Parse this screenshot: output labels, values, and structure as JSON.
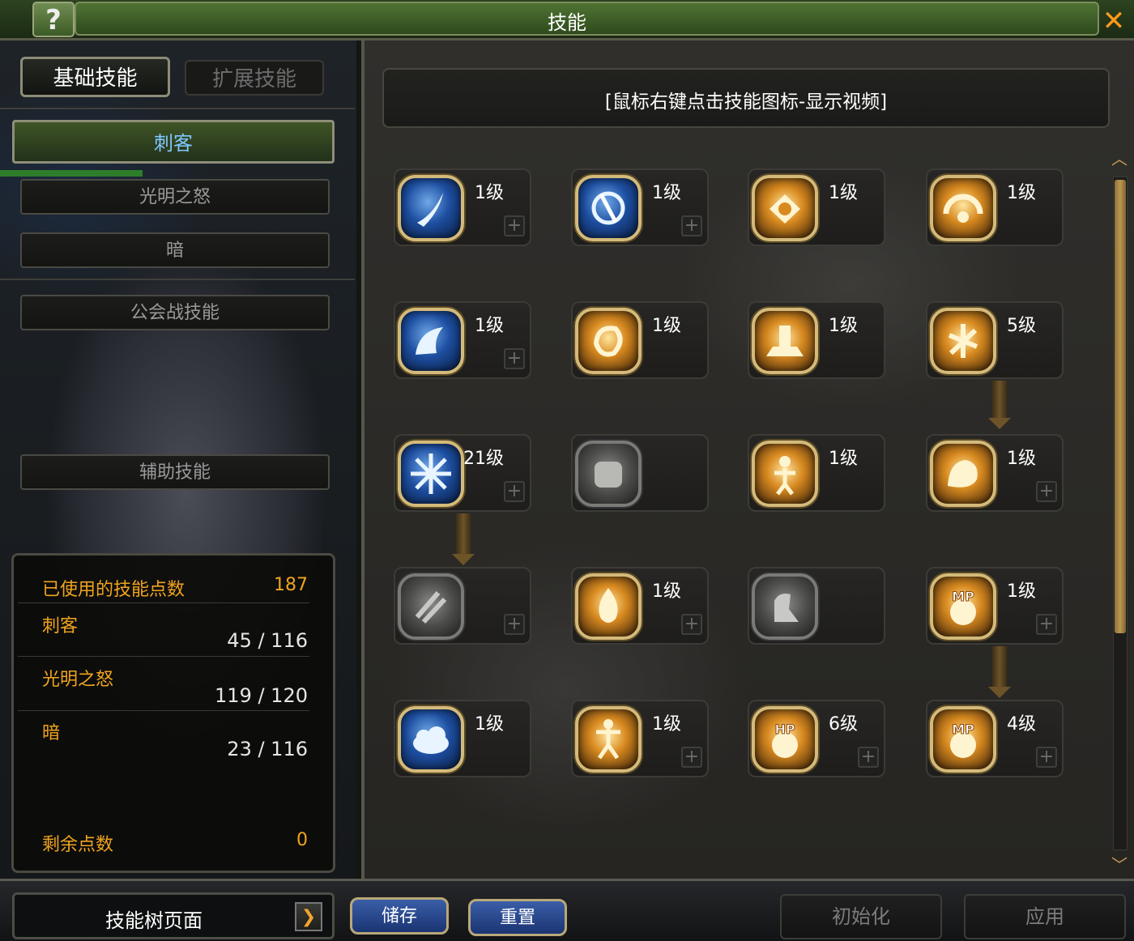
{
  "window": {
    "title": "技能",
    "help_label": "?",
    "close_label": "✕"
  },
  "tabs": [
    {
      "label": "基础技能",
      "active": true
    },
    {
      "label": "扩展技能",
      "active": false
    }
  ],
  "categories": [
    {
      "label": "刺客",
      "active": true
    },
    {
      "label": "光明之怒",
      "active": false
    },
    {
      "label": "暗",
      "active": false
    },
    {
      "label": "公会战技能",
      "active": false
    },
    {
      "label": "辅助技能",
      "active": false
    }
  ],
  "stats": {
    "used_label": "已使用的技能点数",
    "used_value": "187",
    "rows": [
      {
        "label": "刺客",
        "value": "45 / 116"
      },
      {
        "label": "光明之怒",
        "value": "119 / 120"
      },
      {
        "label": "暗",
        "value": "23 / 116"
      }
    ],
    "remaining_label": "剩余点数",
    "remaining_value": "0"
  },
  "hint": "[鼠标右键点击技能图标-显示视频]",
  "skills": [
    {
      "level": "1级",
      "style": "blue",
      "icon": "slash-icon",
      "plus": true
    },
    {
      "level": "1级",
      "style": "blue",
      "icon": "whirl-kick-icon",
      "plus": true
    },
    {
      "level": "1级",
      "style": "gold",
      "icon": "burst-strike-icon",
      "plus": false
    },
    {
      "level": "1级",
      "style": "gold",
      "icon": "gauge-icon",
      "plus": false
    },
    {
      "level": "1级",
      "style": "blue",
      "icon": "leap-icon",
      "plus": true
    },
    {
      "level": "1级",
      "style": "gold",
      "icon": "spin-kick-icon",
      "plus": false
    },
    {
      "level": "1级",
      "style": "gold",
      "icon": "ground-slam-icon",
      "plus": false
    },
    {
      "level": "5级",
      "style": "gold",
      "icon": "dancer-icon",
      "plus": false
    },
    {
      "level": "21级",
      "style": "blue",
      "icon": "shatter-icon",
      "plus": true
    },
    {
      "level": "",
      "style": "gray",
      "icon": "fist-icon",
      "plus": false
    },
    {
      "level": "1级",
      "style": "gold",
      "icon": "radiant-figure-icon",
      "plus": false
    },
    {
      "level": "1级",
      "style": "gold",
      "icon": "beast-icon",
      "plus": true
    },
    {
      "level": "",
      "style": "gray",
      "icon": "claw-icon",
      "plus": true
    },
    {
      "level": "1级",
      "style": "gold",
      "icon": "flame-icon",
      "plus": true
    },
    {
      "level": "",
      "style": "gray",
      "icon": "crouch-icon",
      "plus": false
    },
    {
      "level": "1级",
      "style": "gold",
      "icon": "mp-burst-icon",
      "plus": true
    },
    {
      "level": "1级",
      "style": "blue",
      "icon": "cloud-icon",
      "plus": false
    },
    {
      "level": "1级",
      "style": "gold",
      "icon": "jump-icon",
      "plus": true
    },
    {
      "level": "6级",
      "style": "gold",
      "icon": "hp-boost-icon",
      "plus": true
    },
    {
      "level": "4级",
      "style": "gold",
      "icon": "mp-boost-icon",
      "plus": true
    }
  ],
  "icon_text": {
    "mp": "MP",
    "hp": "HP"
  },
  "bottom": {
    "tree_select": "技能树页面",
    "save": "储存",
    "reset": "重置",
    "init": "初始化",
    "apply": "应用"
  }
}
